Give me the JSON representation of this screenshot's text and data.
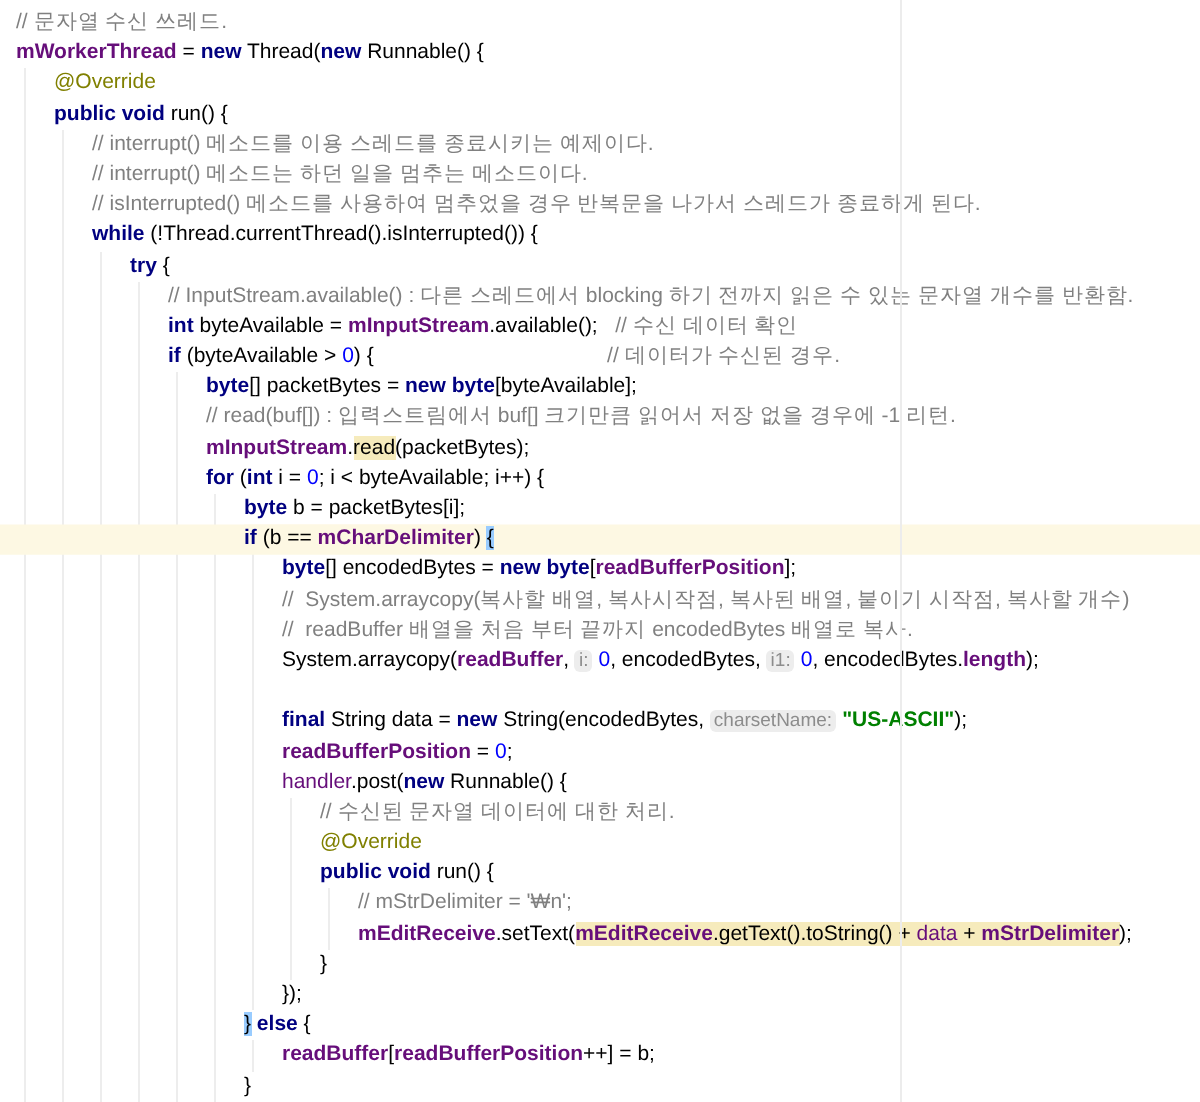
{
  "editor": {
    "lines": [
      {
        "current": false,
        "tokens": [
          {
            "kind": "comment",
            "text": "// 문자열 수신 쓰레드."
          }
        ]
      },
      {
        "current": false,
        "tokens": [
          {
            "kind": "field",
            "text": "mWorkerThread"
          },
          {
            "kind": "plain",
            "text": " = "
          },
          {
            "kind": "keyword",
            "text": "new"
          },
          {
            "kind": "plain",
            "text": " Thread("
          },
          {
            "kind": "keyword",
            "text": "new"
          },
          {
            "kind": "plain",
            "text": " Runnable() {"
          }
        ],
        "children": [
          {
            "current": false,
            "tokens": [
              {
                "kind": "annotation",
                "text": "@Override"
              }
            ]
          },
          {
            "current": false,
            "tokens": [
              {
                "kind": "keyword",
                "text": "public void"
              },
              {
                "kind": "plain",
                "text": " run() {"
              }
            ],
            "children": [
              {
                "current": false,
                "tokens": [
                  {
                    "kind": "comment",
                    "text": "// interrupt() 메소드를 이용 스레드를 종료시키는 예제이다."
                  }
                ]
              },
              {
                "current": false,
                "tokens": [
                  {
                    "kind": "comment",
                    "text": "// interrupt() 메소드는 하던 일을 멈추는 메소드이다."
                  }
                ]
              },
              {
                "current": false,
                "tokens": [
                  {
                    "kind": "comment",
                    "text": "// isInterrupted() 메소드를 사용하여 멈추었을 경우 반복문을 나가서 스레드가 종료하게 된다."
                  }
                ]
              },
              {
                "current": false,
                "tokens": [
                  {
                    "kind": "keyword",
                    "text": "while"
                  },
                  {
                    "kind": "plain",
                    "text": " (!Thread.currentThread().isInterrupted()) {"
                  }
                ],
                "children": [
                  {
                    "current": false,
                    "tokens": [
                      {
                        "kind": "keyword",
                        "text": "try"
                      },
                      {
                        "kind": "plain",
                        "text": " {"
                      }
                    ],
                    "children": [
                      {
                        "current": false,
                        "tokens": [
                          {
                            "kind": "comment",
                            "text": "// InputStream.available() : 다른 스레드에서 blocking 하기 전까지 읽은 수 있는 문자열 개수를 반환함."
                          }
                        ]
                      },
                      {
                        "current": false,
                        "tokens": [
                          {
                            "kind": "keyword",
                            "text": "int"
                          },
                          {
                            "kind": "plain",
                            "text": " byteAvailable = "
                          },
                          {
                            "kind": "field",
                            "text": "mInputStream"
                          },
                          {
                            "kind": "plain",
                            "text": ".available();   "
                          },
                          {
                            "kind": "comment",
                            "text": "// 수신 데이터 확인"
                          }
                        ]
                      },
                      {
                        "current": false,
                        "tokens": [
                          {
                            "kind": "keyword",
                            "text": "if"
                          },
                          {
                            "kind": "plain",
                            "text": " (byteAvailable > "
                          },
                          {
                            "kind": "number",
                            "text": "0"
                          },
                          {
                            "kind": "plain",
                            "text": ") {                                        "
                          },
                          {
                            "kind": "comment",
                            "text": "// 데이터가 수신된 경우."
                          }
                        ],
                        "children": [
                          {
                            "current": false,
                            "tokens": [
                              {
                                "kind": "keyword",
                                "text": "byte"
                              },
                              {
                                "kind": "plain",
                                "text": "[] packetBytes = "
                              },
                              {
                                "kind": "keyword",
                                "text": "new byte"
                              },
                              {
                                "kind": "plain",
                                "text": "[byteAvailable];"
                              }
                            ]
                          },
                          {
                            "current": false,
                            "tokens": [
                              {
                                "kind": "comment",
                                "text": "// read(buf[]) : 입력스트림에서 buf[] 크기만큼 읽어서 저장 없을 경우에 -1 리턴."
                              }
                            ]
                          },
                          {
                            "current": false,
                            "tokens": [
                              {
                                "kind": "field",
                                "text": "mInputStream"
                              },
                              {
                                "kind": "plain",
                                "text": "."
                              },
                              {
                                "kind": "plain",
                                "text": "read",
                                "highlighted": true
                              },
                              {
                                "kind": "plain",
                                "text": "(packetBytes);"
                              }
                            ]
                          },
                          {
                            "current": false,
                            "tokens": [
                              {
                                "kind": "keyword",
                                "text": "for"
                              },
                              {
                                "kind": "plain",
                                "text": " ("
                              },
                              {
                                "kind": "keyword",
                                "text": "int"
                              },
                              {
                                "kind": "plain",
                                "text": " i = "
                              },
                              {
                                "kind": "number",
                                "text": "0"
                              },
                              {
                                "kind": "plain",
                                "text": "; i < byteAvailable; i++) {"
                              }
                            ],
                            "children": [
                              {
                                "current": false,
                                "tokens": [
                                  {
                                    "kind": "keyword",
                                    "text": "byte"
                                  },
                                  {
                                    "kind": "plain",
                                    "text": " b = packetBytes[i];"
                                  }
                                ]
                              },
                              {
                                "current": true,
                                "tokens": [
                                  {
                                    "kind": "keyword",
                                    "text": "if"
                                  },
                                  {
                                    "kind": "plain",
                                    "text": " (b == "
                                  },
                                  {
                                    "kind": "field",
                                    "text": "mCharDelimiter"
                                  },
                                  {
                                    "kind": "plain",
                                    "text": ") "
                                  },
                                  {
                                    "kind": "plain",
                                    "text": "{",
                                    "matched": true
                                  }
                                ],
                                "children": [
                                  {
                                    "current": false,
                                    "tokens": [
                                      {
                                        "kind": "keyword",
                                        "text": "byte"
                                      },
                                      {
                                        "kind": "plain",
                                        "text": "[] encodedBytes = "
                                      },
                                      {
                                        "kind": "keyword",
                                        "text": "new byte"
                                      },
                                      {
                                        "kind": "plain",
                                        "text": "["
                                      },
                                      {
                                        "kind": "field",
                                        "text": "readBufferPosition"
                                      },
                                      {
                                        "kind": "plain",
                                        "text": "];"
                                      }
                                    ]
                                  },
                                  {
                                    "current": false,
                                    "tokens": [
                                      {
                                        "kind": "comment",
                                        "text": "//  System.arraycopy(복사할 배열, 복사시작점, 복사된 배열, 붙이기 시작점, 복사할 개수)"
                                      }
                                    ]
                                  },
                                  {
                                    "current": false,
                                    "tokens": [
                                      {
                                        "kind": "comment",
                                        "text": "//  readBuffer 배열을 처음 부터 끝까지 encodedBytes 배열로 복사."
                                      }
                                    ]
                                  },
                                  {
                                    "current": false,
                                    "tokens": [
                                      {
                                        "kind": "plain",
                                        "text": "System.arraycopy("
                                      },
                                      {
                                        "kind": "field",
                                        "text": "readBuffer"
                                      },
                                      {
                                        "kind": "plain",
                                        "text": ", "
                                      },
                                      {
                                        "kind": "hint",
                                        "text": "i:"
                                      },
                                      {
                                        "kind": "number",
                                        "text": "0"
                                      },
                                      {
                                        "kind": "plain",
                                        "text": ", encodedBytes, "
                                      },
                                      {
                                        "kind": "hint",
                                        "text": "i1:"
                                      },
                                      {
                                        "kind": "number",
                                        "text": "0"
                                      },
                                      {
                                        "kind": "plain",
                                        "text": ", encodedBytes."
                                      },
                                      {
                                        "kind": "field",
                                        "text": "length"
                                      },
                                      {
                                        "kind": "plain",
                                        "text": ");"
                                      }
                                    ]
                                  },
                                  {
                                    "current": false
                                  },
                                  {
                                    "current": false,
                                    "tokens": [
                                      {
                                        "kind": "keyword",
                                        "text": "final"
                                      },
                                      {
                                        "kind": "plain",
                                        "text": " String data = "
                                      },
                                      {
                                        "kind": "keyword",
                                        "text": "new"
                                      },
                                      {
                                        "kind": "plain",
                                        "text": " String(encodedBytes, "
                                      },
                                      {
                                        "kind": "hint",
                                        "text": "charsetName:"
                                      },
                                      {
                                        "kind": "string",
                                        "text": "\"US-ASCII\""
                                      },
                                      {
                                        "kind": "plain",
                                        "text": ");"
                                      }
                                    ]
                                  },
                                  {
                                    "current": false,
                                    "tokens": [
                                      {
                                        "kind": "field",
                                        "text": "readBufferPosition"
                                      },
                                      {
                                        "kind": "plain",
                                        "text": " = "
                                      },
                                      {
                                        "kind": "number",
                                        "text": "0"
                                      },
                                      {
                                        "kind": "plain",
                                        "text": ";"
                                      }
                                    ]
                                  },
                                  {
                                    "current": false,
                                    "tokens": [
                                      {
                                        "kind": "variable",
                                        "text": "handler"
                                      },
                                      {
                                        "kind": "plain",
                                        "text": ".post("
                                      },
                                      {
                                        "kind": "keyword",
                                        "text": "new"
                                      },
                                      {
                                        "kind": "plain",
                                        "text": " Runnable() {"
                                      }
                                    ],
                                    "children": [
                                      {
                                        "current": false,
                                        "tokens": [
                                          {
                                            "kind": "comment",
                                            "text": "// 수신된 문자열 데이터에 대한 처리."
                                          }
                                        ]
                                      },
                                      {
                                        "current": false,
                                        "tokens": [
                                          {
                                            "kind": "annotation",
                                            "text": "@Override"
                                          }
                                        ]
                                      },
                                      {
                                        "current": false,
                                        "tokens": [
                                          {
                                            "kind": "keyword",
                                            "text": "public void"
                                          },
                                          {
                                            "kind": "plain",
                                            "text": " run() {"
                                          }
                                        ],
                                        "children": [
                                          {
                                            "current": false,
                                            "tokens": [
                                              {
                                                "kind": "comment",
                                                "text": "// mStrDelimiter = '₩n';"
                                              }
                                            ]
                                          },
                                          {
                                            "current": false,
                                            "tokens": [
                                              {
                                                "kind": "field",
                                                "text": "mEditReceive"
                                              },
                                              {
                                                "kind": "plain",
                                                "text": ".setText("
                                              },
                                              {
                                                "kind": "field",
                                                "text": "mEditReceive",
                                                "highlighted": true
                                              },
                                              {
                                                "kind": "plain",
                                                "text": ".getText().toString() + ",
                                                "highlighted": true
                                              },
                                              {
                                                "kind": "variable",
                                                "text": "data",
                                                "highlighted": true
                                              },
                                              {
                                                "kind": "plain",
                                                "text": " + ",
                                                "highlighted": true
                                              },
                                              {
                                                "kind": "field",
                                                "text": "mStrDelimiter",
                                                "highlighted": true
                                              },
                                              {
                                                "kind": "plain",
                                                "text": ");"
                                              }
                                            ]
                                          }
                                        ]
                                      },
                                      {
                                        "current": false,
                                        "tokens": [
                                          {
                                            "kind": "plain",
                                            "text": "}"
                                          }
                                        ]
                                      }
                                    ]
                                  },
                                  {
                                    "current": false,
                                    "tokens": [
                                      {
                                        "kind": "plain",
                                        "text": "});"
                                      }
                                    ]
                                  }
                                ]
                              },
                              {
                                "current": false,
                                "tokens": [
                                  {
                                    "kind": "plain",
                                    "text": "}",
                                    "matched": true
                                  },
                                  {
                                    "kind": "keyword",
                                    "text": " else"
                                  },
                                  {
                                    "kind": "plain",
                                    "text": " {"
                                  }
                                ],
                                "children": [
                                  {
                                    "current": false,
                                    "tokens": [
                                      {
                                        "kind": "field",
                                        "text": "readBuffer"
                                      },
                                      {
                                        "kind": "plain",
                                        "text": "["
                                      },
                                      {
                                        "kind": "field",
                                        "text": "readBufferPosition"
                                      },
                                      {
                                        "kind": "plain",
                                        "text": "++] = b;"
                                      }
                                    ]
                                  }
                                ]
                              },
                              {
                                "current": false,
                                "tokens": [
                                  {
                                    "kind": "plain",
                                    "text": "}"
                                  }
                                ]
                              }
                            ]
                          }
                        ]
                      }
                    ]
                  }
                ]
              }
            ]
          }
        ]
      }
    ]
  }
}
